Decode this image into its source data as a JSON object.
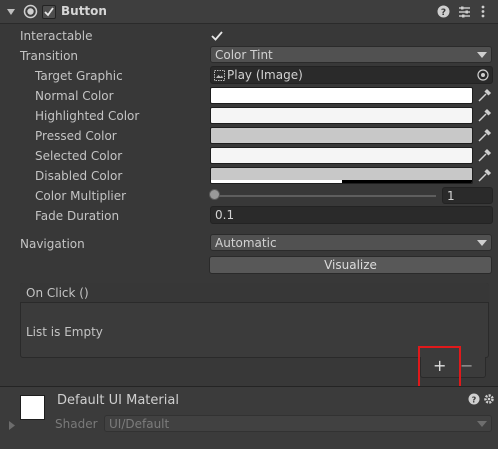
{
  "header": {
    "title": "Button"
  },
  "rows": {
    "interactable": "Interactable",
    "transition": "Transition",
    "transition_value": "Color Tint",
    "target_graphic": "Target Graphic",
    "target_graphic_value": "Play (Image)",
    "normal_color": "Normal Color",
    "highlighted_color": "Highlighted Color",
    "pressed_color": "Pressed Color",
    "selected_color": "Selected Color",
    "disabled_color": "Disabled Color",
    "color_multiplier": "Color Multiplier",
    "color_multiplier_value": "1",
    "fade_duration": "Fade Duration",
    "fade_duration_value": "0.1",
    "navigation": "Navigation",
    "navigation_value": "Automatic",
    "visualize": "Visualize"
  },
  "on_click": {
    "title": "On Click ()",
    "empty_text": "List is Empty",
    "add_label": "+",
    "remove_label": "−"
  },
  "material": {
    "name": "Default UI Material",
    "shader_label": "Shader",
    "shader_value": "UI/Default"
  },
  "colors": {
    "normal": "#ffffff",
    "highlighted": "#f5f5f5",
    "pressed": "#c8c8c8",
    "selected": "#f5f5f5",
    "disabled": "#c8c8c8",
    "highlight_box": "#e0191b"
  },
  "slider": {
    "color_multiplier_fraction": 0.0
  }
}
